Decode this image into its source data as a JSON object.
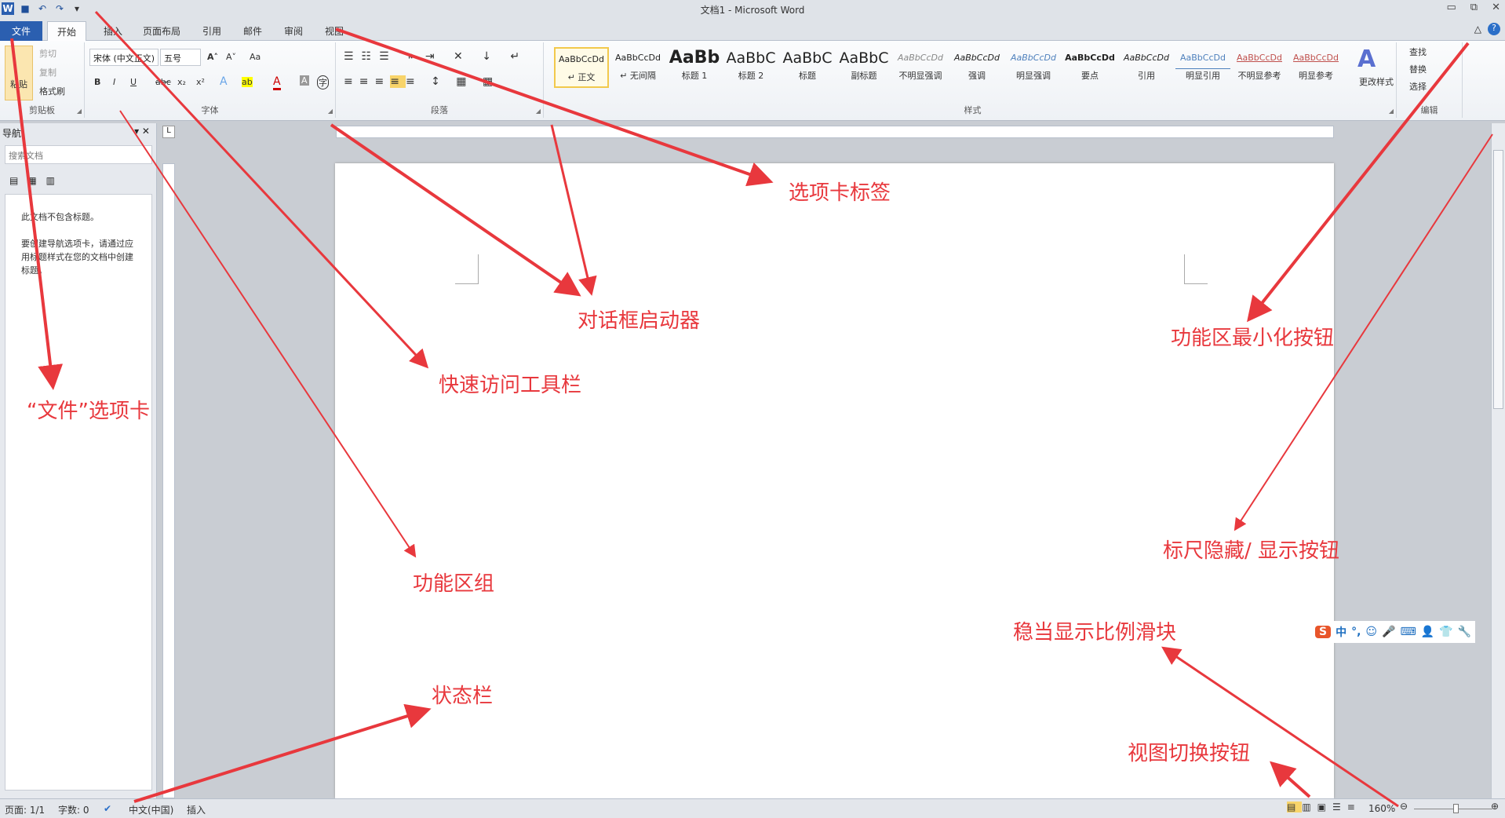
{
  "window": {
    "title": "文档1 - Microsoft Word",
    "min": "▭",
    "restore": "⧉",
    "close": "✕"
  },
  "qat": {
    "word": "W",
    "save": "■",
    "undo": "↶",
    "redo": "↷",
    "customize": "▾"
  },
  "tabs": [
    "文件",
    "开始",
    "插入",
    "页面布局",
    "引用",
    "邮件",
    "审阅",
    "视图"
  ],
  "ribbon_right": {
    "minimize": "△",
    "help": "?"
  },
  "clipboard": {
    "paste": "粘贴",
    "cut": "剪切",
    "copy": "复制",
    "format_painter": "格式刷",
    "label": "剪贴板"
  },
  "font": {
    "name": "宋体 (中文正文)",
    "size": "五号",
    "label": "字体",
    "buttons": [
      "B",
      "I",
      "U",
      "abc",
      "x₂",
      "x²",
      "A",
      "ab",
      "A",
      "A",
      "字"
    ],
    "grow": "A˄",
    "shrink": "A˅",
    "case": "Aa"
  },
  "paragraph": {
    "label": "段落"
  },
  "styles": {
    "label": "样式",
    "items": [
      {
        "preview": "AaBbCcDd",
        "name": "↵ 正文"
      },
      {
        "preview": "AaBbCcDd",
        "name": "↵ 无间隔"
      },
      {
        "preview": "AaBb",
        "name": "标题 1"
      },
      {
        "preview": "AaBbC",
        "name": "标题 2"
      },
      {
        "preview": "AaBbC",
        "name": "标题"
      },
      {
        "preview": "AaBbC",
        "name": "副标题"
      },
      {
        "preview": "AaBbCcDd",
        "name": "不明显强调"
      },
      {
        "preview": "AaBbCcDd",
        "name": "强调"
      },
      {
        "preview": "AaBbCcDd",
        "name": "明显强调"
      },
      {
        "preview": "AaBbCcDd",
        "name": "要点"
      },
      {
        "preview": "AaBbCcDd",
        "name": "引用"
      },
      {
        "preview": "AaBbCcDd",
        "name": "明显引用"
      },
      {
        "preview": "AaBbCcDd",
        "name": "不明显参考"
      },
      {
        "preview": "AaBbCcDd",
        "name": "明显参考"
      }
    ],
    "change": "更改样式"
  },
  "editing": {
    "find": "查找",
    "replace": "替换",
    "select": "选择",
    "label": "编辑"
  },
  "nav": {
    "title": "导航",
    "search_placeholder": "搜索文档",
    "msg1": "此文档不包含标题。",
    "msg2": "要创建导航选项卡，请通过应用标题样式在您的文档中创建标题。"
  },
  "status": {
    "page": "页面: 1/1",
    "words": "字数: 0",
    "lang": "中文(中国)",
    "mode": "插入",
    "zoom": "160%"
  },
  "ime": {
    "logo": "S",
    "items": [
      "中",
      "°,",
      "☺",
      "🎤",
      "⌨",
      "👤",
      "👕",
      "🔧"
    ]
  },
  "annotations": [
    "选项卡标签",
    "对话框启动器",
    "功能区最小化按钮",
    "快速访问工具栏",
    "“文件”选项卡",
    "功能区组",
    "标尺隐藏/ 显示按钮",
    "稳当显示比例滑块",
    "状态栏",
    "视图切换按钮"
  ],
  "colors": {
    "annotation": "#e8383d",
    "file_tab": "#2b5fb0"
  }
}
